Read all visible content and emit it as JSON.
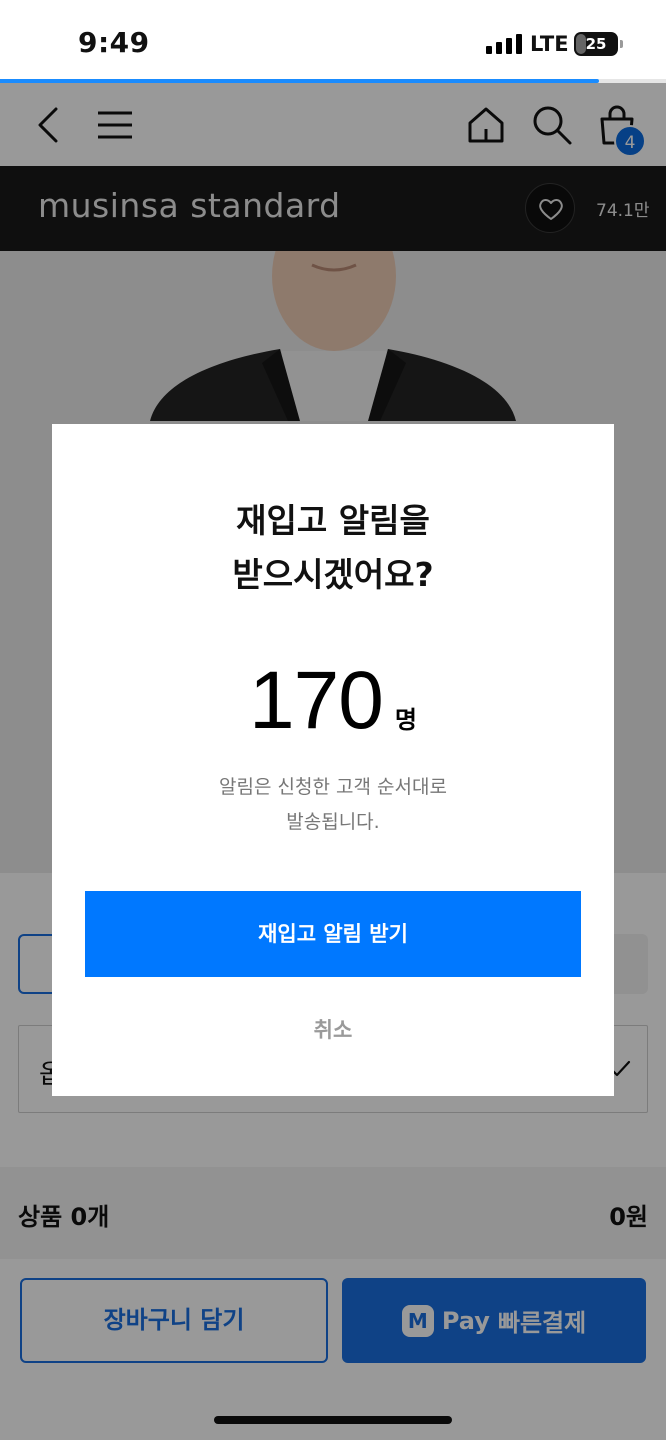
{
  "status_bar": {
    "time": "9:49",
    "network": "LTE",
    "battery": "25",
    "battery_level_percent": 25
  },
  "page_load_progress_percent": 90,
  "nav": {
    "cart_count": "4"
  },
  "brand": {
    "name": "musinsa standard",
    "like_count": "74.1만"
  },
  "options": {
    "select_partial_text": "옵"
  },
  "summary": {
    "label": "상품 0개",
    "price": "0원"
  },
  "bottom": {
    "cart_button_label": "장바구니 담기",
    "pay_logo": "M",
    "pay_word": "Pay",
    "pay_button_label": "빠른결제"
  },
  "modal": {
    "title": "재입고 알림을\n받으시겠어요?",
    "count": "170",
    "count_unit": "명",
    "description": "알림은 신청한 고객 순서대로\n발송됩니다.",
    "confirm_label": "재입고 알림 받기",
    "cancel_label": "취소"
  },
  "colors": {
    "accent_blue": "#0078ff",
    "brand_blue": "#1a6fe0",
    "brand_bar": "#1a1a1a",
    "badge_blue": "#0a6bdf"
  },
  "icons": [
    "back-icon",
    "menu-icon",
    "home-icon",
    "search-icon",
    "cart-icon",
    "heart-icon",
    "check-icon"
  ]
}
